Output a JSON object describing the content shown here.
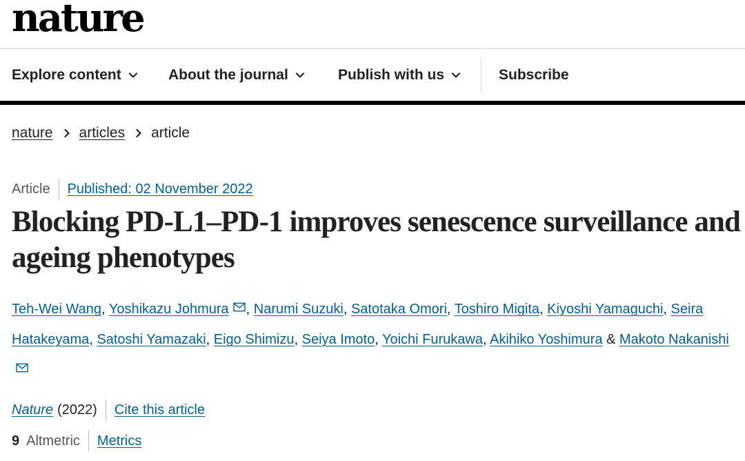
{
  "brand": {
    "logo_text": "nature"
  },
  "nav": {
    "items": [
      {
        "label": "Explore content",
        "has_menu": true
      },
      {
        "label": "About the journal",
        "has_menu": true
      },
      {
        "label": "Publish with us",
        "has_menu": true
      },
      {
        "label": "Subscribe",
        "has_menu": false
      }
    ]
  },
  "breadcrumb": {
    "items": [
      {
        "label": "nature",
        "link": true
      },
      {
        "label": "articles",
        "link": true
      },
      {
        "label": "article",
        "link": false
      }
    ]
  },
  "article": {
    "type": "Article",
    "published": "Published: 02 November 2022",
    "title": "Blocking PD-L1–PD-1 improves senescence surveillance and ageing phenotypes",
    "authors": [
      {
        "name": "Teh-Wei Wang",
        "corresponding": false
      },
      {
        "name": "Yoshikazu Johmura",
        "corresponding": true
      },
      {
        "name": "Narumi Suzuki",
        "corresponding": false
      },
      {
        "name": "Satotaka Omori",
        "corresponding": false
      },
      {
        "name": "Toshiro Migita",
        "corresponding": false
      },
      {
        "name": "Kiyoshi Yamaguchi",
        "corresponding": false
      },
      {
        "name": "Seira Hatakeyama",
        "corresponding": false
      },
      {
        "name": "Satoshi Yamazaki",
        "corresponding": false
      },
      {
        "name": "Eigo Shimizu",
        "corresponding": false
      },
      {
        "name": "Seiya Imoto",
        "corresponding": false
      },
      {
        "name": "Yoichi Furukawa",
        "corresponding": false
      },
      {
        "name": "Akihiko Yoshimura",
        "corresponding": false
      },
      {
        "name": "Makoto Nakanishi",
        "corresponding": true
      }
    ],
    "author_separator": ", ",
    "author_last_join": " & ",
    "journal": "Nature",
    "year": "(2022)",
    "cite_label": "Cite this article",
    "altmetric_count": "9",
    "altmetric_label": "Altmetric",
    "metrics_label": "Metrics"
  },
  "colors": {
    "link": "#025e8d",
    "text": "#222222",
    "rule": "#000000"
  }
}
